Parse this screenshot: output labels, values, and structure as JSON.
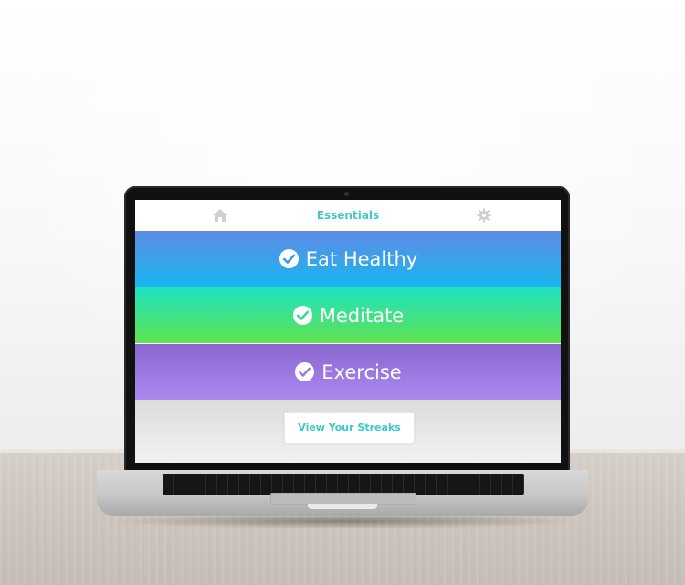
{
  "header": {
    "title": "Essentials",
    "left_icon": "home-icon",
    "right_icon": "gear-icon"
  },
  "habits": [
    {
      "label": "Eat Healthy",
      "icon": "check-circle-icon",
      "completed": true
    },
    {
      "label": "Meditate",
      "icon": "check-circle-icon",
      "completed": true
    },
    {
      "label": "Exercise",
      "icon": "check-circle-icon",
      "completed": true
    }
  ],
  "footer": {
    "button_label": "View Your Streaks"
  },
  "colors": {
    "accent": "#3ec7cc",
    "habit_1": "#18b6ef",
    "habit_2": "#5fe24f",
    "habit_3": "#ab8af0",
    "icon_gray": "#cfcfcf"
  }
}
